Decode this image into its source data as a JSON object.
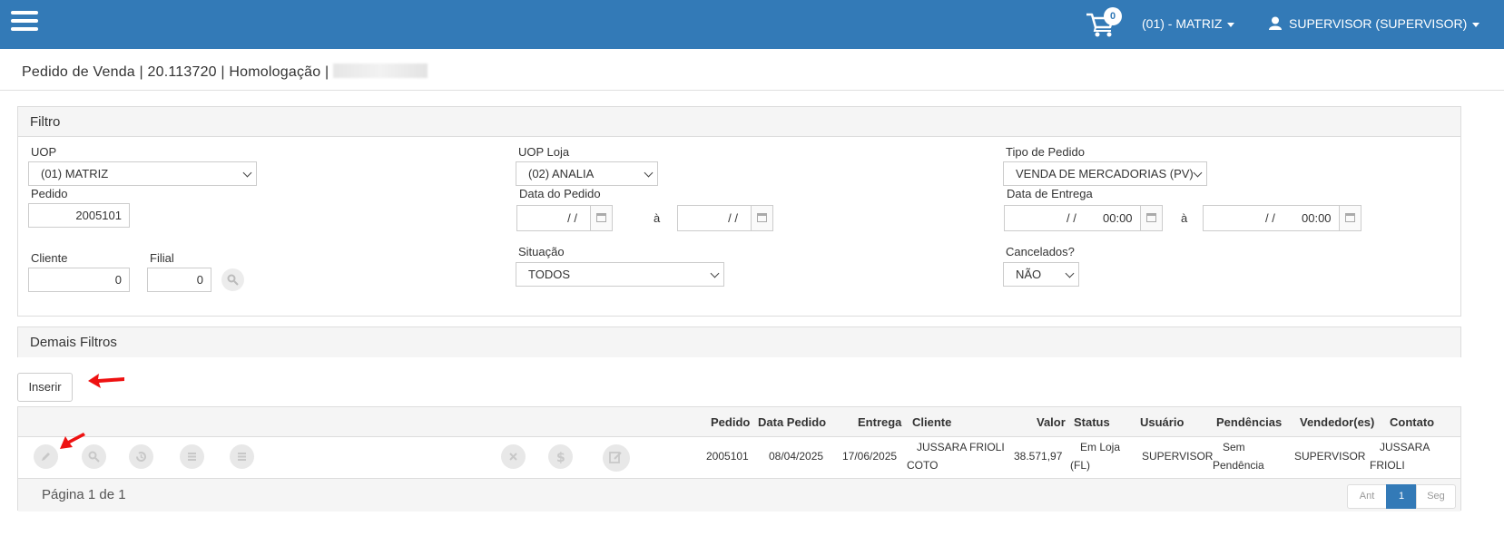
{
  "header": {
    "cart_count": "0",
    "company_menu": "(01) - MATRIZ",
    "user_menu": "SUPERVISOR (SUPERVISOR)"
  },
  "page": {
    "title": "Pedido de Venda | 20.113720 | Homologação |"
  },
  "filter_panel": {
    "title": "Filtro",
    "uop_label": "UOP",
    "uop_value": "(01) MATRIZ",
    "pedido_label": "Pedido",
    "pedido_value": "2005101",
    "cliente_label": "Cliente",
    "cliente_value": "0",
    "filial_label": "Filial",
    "filial_value": "0",
    "uop_loja_label": "UOP Loja",
    "uop_loja_value": "(02) ANALIA",
    "data_pedido_label": "Data do Pedido",
    "data_pedido_from": "/ /",
    "data_pedido_to": "/ /",
    "range_sep": "à",
    "situacao_label": "Situação",
    "situacao_value": "TODOS",
    "tipo_pedido_label": "Tipo de Pedido",
    "tipo_pedido_value": "VENDA DE MERCADORIAS (PV)",
    "data_entrega_label": "Data de Entrega",
    "data_entrega_from_date": "/ /",
    "data_entrega_from_time": "00:00",
    "data_entrega_to_date": "/ /",
    "data_entrega_to_time": "00:00",
    "cancelados_label": "Cancelados?",
    "cancelados_value": "NÃO"
  },
  "demais_filtros": {
    "title": "Demais Filtros"
  },
  "actions": {
    "insert_label": "Inserir"
  },
  "grid": {
    "columns": [
      "Pedido",
      "Data Pedido",
      "Entrega",
      "Cliente",
      "Valor",
      "Status",
      "Usuário",
      "Pendências",
      "Vendedor(es)",
      "Contato"
    ],
    "rows": [
      {
        "pedido": "2005101",
        "data_pedido": "08/04/2025",
        "entrega": "17/06/2025",
        "cliente_line1": "JUSSARA FRIOLI",
        "cliente_line2": "COTO",
        "valor": "38.571,97",
        "status_line1": "Em Loja",
        "status_line2": "(FL)",
        "usuario": "SUPERVISOR",
        "pendencias_line1": "Sem",
        "pendencias_line2": "Pendência",
        "vendedor": "SUPERVISOR",
        "contato_line1": "JUSSARA",
        "contato_line2": "FRIOLI"
      }
    ],
    "row_icons": [
      "edit-icon",
      "search-icon",
      "history-icon",
      "list-icon",
      "menu-icon",
      "cancel-icon",
      "dollar-icon",
      "note-edit-icon"
    ],
    "footer_text": "Página 1 de 1",
    "pager": {
      "prev": "Ant",
      "current": "1",
      "next": "Seg"
    }
  },
  "colors": {
    "header": "#337ab7",
    "accent": "#337ab7",
    "annotation_arrow": "#e11"
  }
}
